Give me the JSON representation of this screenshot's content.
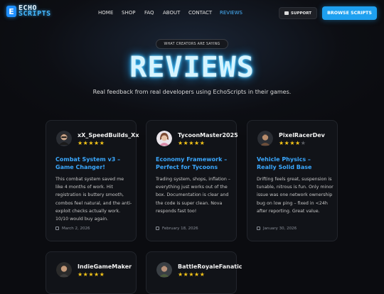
{
  "nav": {
    "logo_mark": "E",
    "logo_line1": "ECHO",
    "logo_line2": "SCRIPTS",
    "items": [
      {
        "label": "HOME",
        "active": false
      },
      {
        "label": "SHOP",
        "active": false
      },
      {
        "label": "FAQ",
        "active": false
      },
      {
        "label": "ABOUT",
        "active": false
      },
      {
        "label": "CONTACT",
        "active": false
      },
      {
        "label": "REVIEWS",
        "active": true
      }
    ],
    "support_label": "SUPPORT",
    "support_icon": "ticket-icon",
    "browse_label": "BROWSE SCRIPTS"
  },
  "hero": {
    "eyebrow": "WHAT CREATORS ARE SAYING",
    "title": "REVIEWS",
    "subtitle": "Real feedback from real developers using EchoScripts in their games."
  },
  "colors": {
    "accent": "#3aa8ff",
    "star": "#f5c518",
    "background": "#0b0c10"
  },
  "reviews": [
    {
      "user": "xX_SpeedBuilds_Xx",
      "rating": 5,
      "title": "Combat System v3 – Game Changer!",
      "body": "This combat system saved me like 4 months of work. Hit registration is buttery smooth, combos feel natural, and the anti-exploit checks actually work. 10/10 would buy again.",
      "date": "March 2, 2026"
    },
    {
      "user": "TycoonMaster2025",
      "rating": 5,
      "title": "Economy Framework – Perfect for Tycoons",
      "body": "Trading system, shops, inflation – everything just works out of the box. Documentation is clear and the code is super clean. Nova responds fast too!",
      "date": "February 18, 2026"
    },
    {
      "user": "PixelRacerDev",
      "rating": 4,
      "title": "Vehicle Physics – Really Solid Base",
      "body": "Drifting feels great, suspension is tunable, nitrous is fun. Only minor issue was one network ownership bug on low ping – fixed in <24h after reporting. Great value.",
      "date": "January 30, 2026"
    },
    {
      "user": "IndieGameMaker",
      "rating": 5
    },
    {
      "user": "BattleRoyaleFanatic",
      "rating": 5
    }
  ]
}
